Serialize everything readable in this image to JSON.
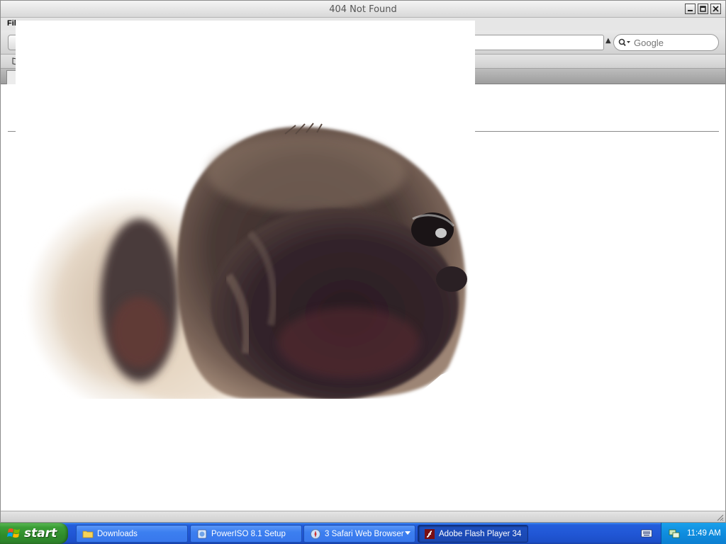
{
  "window": {
    "title": "404 Not Found",
    "menu_partial": "Fil",
    "search_placeholder": "Google"
  },
  "overlay_image": {
    "subject": "pug-face-photo"
  },
  "taskbar": {
    "start_label": "start",
    "buttons": [
      {
        "label": "Downloads",
        "icon": "folder-icon"
      },
      {
        "label": "PowerISO 8.1 Setup",
        "icon": "installer-icon"
      },
      {
        "label": "3 Safari Web Browser",
        "icon": "safari-icon"
      },
      {
        "label": "Adobe Flash Player 34",
        "icon": "flash-icon"
      }
    ],
    "clock": "11:49 AM"
  },
  "colors": {
    "taskbar_blue": "#245edb",
    "start_green": "#3c9f37",
    "tray_blue": "#0f8ddf"
  }
}
